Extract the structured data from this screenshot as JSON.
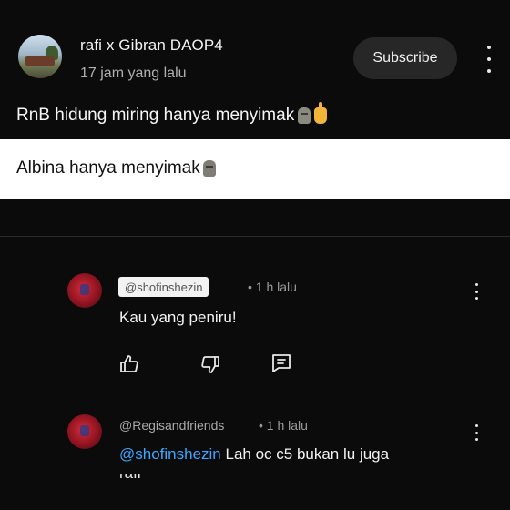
{
  "post": {
    "channel_name": "rafi x Gibran DAOP4",
    "time": "17 jam yang lalu",
    "subscribe_label": "Subscribe",
    "text": "RnB hidung miring hanya menyimak",
    "emojis": [
      "moai-icon",
      "hand-pointing-up-icon"
    ]
  },
  "highlight": {
    "text": "Albina hanya menyimak",
    "emoji": "moai-icon"
  },
  "replies": [
    {
      "handle": "@shofinshezin",
      "meta": "• 1 h lalu",
      "text": "Kau yang peniru!",
      "actions": [
        "like-icon",
        "dislike-icon",
        "reply-icon"
      ]
    },
    {
      "handle": "@Regisandfriends",
      "meta": "• 1 h lalu",
      "mention": "@shofinshezin",
      "text": "Lah oc c5 bukan lu juga",
      "text_cut": "rafi"
    }
  ],
  "colors": {
    "background": "#0b0b0b",
    "mention": "#3ea6ff",
    "subscribe_bg": "#272727"
  }
}
